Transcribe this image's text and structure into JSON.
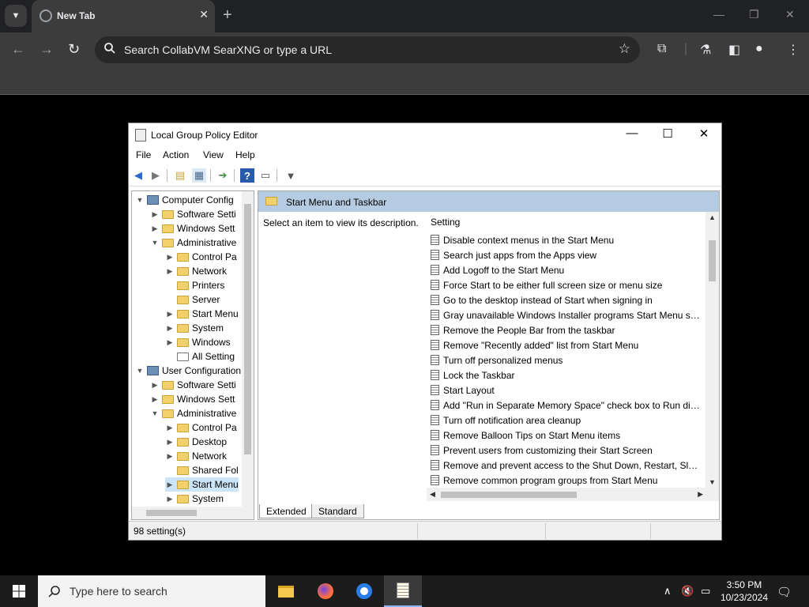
{
  "browser": {
    "tab_title": "New Tab",
    "omnibox_placeholder": "Search CollabVM SearXNG or type a URL"
  },
  "window": {
    "title": "Local Group Policy Editor"
  },
  "menu": {
    "file": "File",
    "action": "Action",
    "view": "View",
    "help": "Help"
  },
  "tree": {
    "items": [
      {
        "label": "Computer Config",
        "level": 0,
        "expanded": true,
        "icon": "computer-icon"
      },
      {
        "label": "Software Setti",
        "level": 1,
        "expanded": false,
        "icon": "folder-icon"
      },
      {
        "label": "Windows Sett",
        "level": 1,
        "expanded": false,
        "icon": "folder-icon"
      },
      {
        "label": "Administrative",
        "level": 1,
        "expanded": true,
        "icon": "folder-icon"
      },
      {
        "label": "Control Pa",
        "level": 2,
        "expanded": false,
        "icon": "folder-icon"
      },
      {
        "label": "Network",
        "level": 2,
        "expanded": false,
        "icon": "folder-icon"
      },
      {
        "label": "Printers",
        "level": 2,
        "icon": "folder-icon"
      },
      {
        "label": "Server",
        "level": 2,
        "icon": "folder-icon"
      },
      {
        "label": "Start Menu",
        "level": 2,
        "expanded": false,
        "icon": "folder-icon"
      },
      {
        "label": "System",
        "level": 2,
        "expanded": false,
        "icon": "folder-icon"
      },
      {
        "label": "Windows",
        "level": 2,
        "expanded": false,
        "icon": "folder-icon"
      },
      {
        "label": "All Setting",
        "level": 2,
        "icon": "settings-list-icon"
      },
      {
        "label": "User Configuration",
        "level": 0,
        "expanded": true,
        "icon": "user-icon"
      },
      {
        "label": "Software Setti",
        "level": 1,
        "expanded": false,
        "icon": "folder-icon"
      },
      {
        "label": "Windows Sett",
        "level": 1,
        "expanded": false,
        "icon": "folder-icon"
      },
      {
        "label": "Administrative",
        "level": 1,
        "expanded": true,
        "icon": "folder-icon"
      },
      {
        "label": "Control Pa",
        "level": 2,
        "expanded": false,
        "icon": "folder-icon"
      },
      {
        "label": "Desktop",
        "level": 2,
        "expanded": false,
        "icon": "folder-icon"
      },
      {
        "label": "Network",
        "level": 2,
        "expanded": false,
        "icon": "folder-icon"
      },
      {
        "label": "Shared Fol",
        "level": 2,
        "icon": "folder-icon"
      },
      {
        "label": "Start Menu",
        "level": 2,
        "expanded": false,
        "icon": "folder-icon",
        "selected": true
      },
      {
        "label": "System",
        "level": 2,
        "expanded": false,
        "icon": "folder-icon"
      }
    ]
  },
  "pane": {
    "header": "Start Menu and Taskbar",
    "description": "Select an item to view its description.",
    "column": "Setting",
    "settings": [
      "Disable context menus in the Start Menu",
      "Search just apps from the Apps view",
      "Add Logoff to the Start Menu",
      "Force Start to be either full screen size or menu size",
      "Go to the desktop instead of Start when signing in",
      "Gray unavailable Windows Installer programs Start Menu sh...",
      "Remove the People Bar from the taskbar",
      "Remove \"Recently added\" list from Start Menu",
      "Turn off personalized menus",
      "Lock the Taskbar",
      "Start Layout",
      "Add \"Run in Separate Memory Space\" check box to Run dial...",
      "Turn off notification area cleanup",
      "Remove Balloon Tips on Start Menu items",
      "Prevent users from customizing their Start Screen",
      "Remove and prevent access to the Shut Down, Restart, Sleep...",
      "Remove common program groups from Start Menu"
    ]
  },
  "view_tabs": {
    "extended": "Extended",
    "standard": "Standard"
  },
  "status": {
    "text": "98 setting(s)"
  },
  "taskbar": {
    "search_placeholder": "Type here to search",
    "time": "3:50 PM",
    "date": "10/23/2024"
  }
}
